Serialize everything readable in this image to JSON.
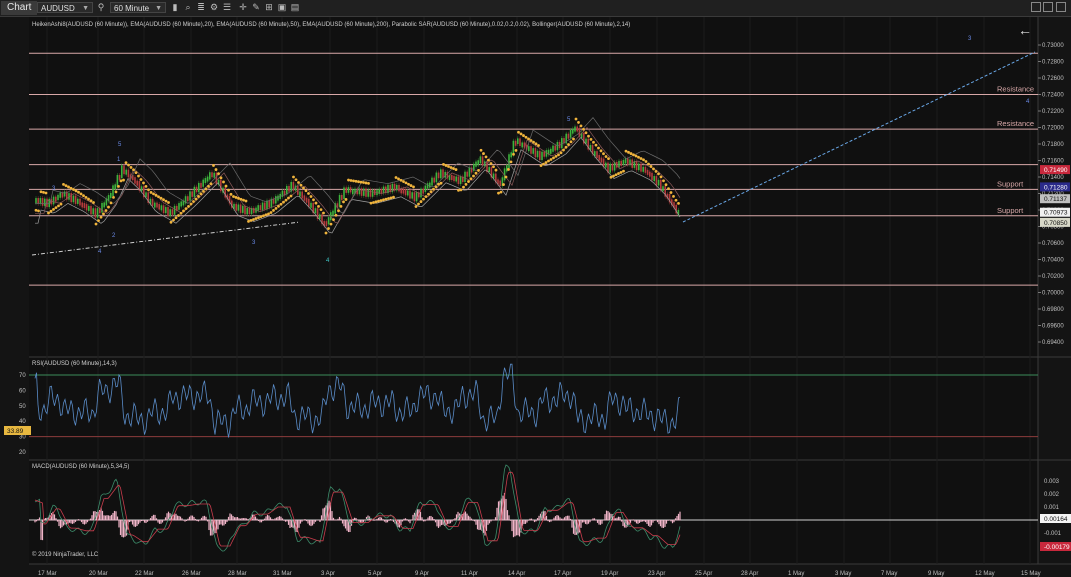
{
  "toolbar": {
    "tab_label": "Chart",
    "instrument": "AUDUSD",
    "interval": "60 Minute"
  },
  "price_panel": {
    "indicator_label": "HeikenAshi8(AUDUSD (60 Minute)), EMA(AUDUSD (60 Minute),20), EMA(AUDUSD (60 Minute),50), EMA(AUDUSD (60 Minute),200), Parabolic SAR(AUDUSD (60 Minute),0.02,0.2,0.02), Bollinger(AUDUSD (60 Minute),2,14)",
    "axis_ticks": [
      "0.73000",
      "0.72800",
      "0.72600",
      "0.72400",
      "0.72200",
      "0.72000",
      "0.71800",
      "0.71600",
      "0.71400",
      "0.71200",
      "0.71000",
      "0.70800",
      "0.70600",
      "0.70400",
      "0.70200",
      "0.70000",
      "0.69800",
      "0.69600",
      "0.69400"
    ],
    "levels": [
      {
        "price": 0.729,
        "label": ""
      },
      {
        "price": 0.724,
        "label": "Resistance"
      },
      {
        "price": 0.7198,
        "label": "Resistance"
      },
      {
        "price": 0.7155,
        "label": ""
      },
      {
        "price": 0.7125,
        "label": "Support"
      },
      {
        "price": 0.7093,
        "label": "Support"
      },
      {
        "price": 0.7009,
        "label": ""
      }
    ],
    "price_markers": [
      {
        "price": 0.7149,
        "label": "0.71490",
        "color": "#c8283c"
      },
      {
        "price": 0.7128,
        "label": "0.71280",
        "color": "#2a2a8a"
      },
      {
        "price": 0.71137,
        "label": "0.71137",
        "color": "#bfbfbf"
      },
      {
        "price": 0.70973,
        "label": "0.70973",
        "color": "#f0f0f0"
      },
      {
        "price": 0.7085,
        "label": "0.70850",
        "color": "#d8d8c8"
      }
    ],
    "wave_labels": [
      "3",
      "4",
      "5",
      "1",
      "2",
      "3",
      "4",
      "5",
      "3",
      "4"
    ]
  },
  "rsi_panel": {
    "label": "RSI(AUDUSD (60 Minute),14,3)",
    "axis_ticks": [
      "70",
      "60",
      "50",
      "40",
      "30",
      "20"
    ],
    "current_value": "33.89",
    "upper_line": 70,
    "lower_line": 30
  },
  "macd_panel": {
    "label": "MACD(AUDUSD (60 Minute),5,34,5)",
    "axis_ticks": [
      "0.003",
      "0.002",
      "0.001",
      "-0.001",
      "-0.002"
    ],
    "value_macd": "0.00164",
    "value_signal": "-0.00179",
    "copyright": "© 2019 NinjaTrader, LLC"
  },
  "x_axis": {
    "labels": [
      "17 Mar",
      "20 Mar",
      "22 Mar",
      "26 Mar",
      "28 Mar",
      "31 Mar",
      "3 Apr",
      "5 Apr",
      "9 Apr",
      "11 Apr",
      "14 Apr",
      "17 Apr",
      "19 Apr",
      "23 Apr",
      "25 Apr",
      "28 Apr",
      "1 May",
      "3 May",
      "7 May",
      "9 May",
      "12 May",
      "15 May"
    ]
  },
  "colors": {
    "background": "#101010",
    "sar_dots": "#f0b43c",
    "ha_up": "#3cb43c",
    "ha_down": "#b43c3c",
    "level_line": "#d8a8a8",
    "rsi_line": "#5a8cc8",
    "macd_hist": "#f0b4c8",
    "projection_line": "#6aa8e8"
  }
}
